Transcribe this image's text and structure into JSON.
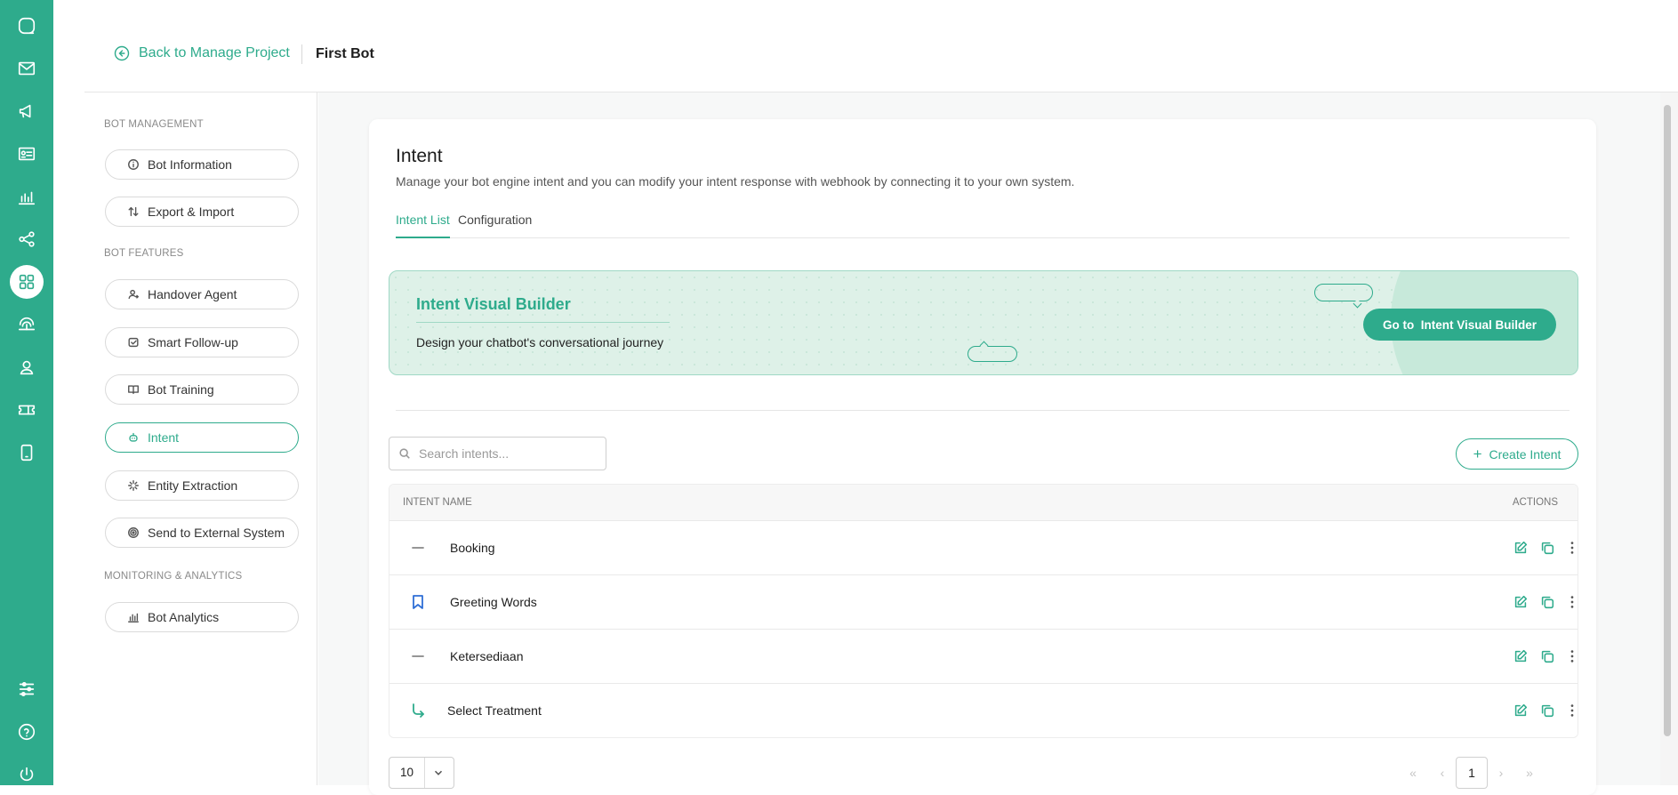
{
  "header": {
    "back_label": "Back to Manage Project",
    "bot_name": "First Bot"
  },
  "sidebar": {
    "sections": [
      {
        "title": "BOT MANAGEMENT"
      },
      {
        "title": "BOT FEATURES"
      },
      {
        "title": "MONITORING & ANALYTICS"
      }
    ],
    "items": [
      {
        "label": "Bot Information",
        "icon": "info-icon"
      },
      {
        "label": "Export & Import",
        "icon": "swap-icon"
      },
      {
        "label": "Handover Agent",
        "icon": "user-icon"
      },
      {
        "label": "Smart Follow-up",
        "icon": "followup-icon"
      },
      {
        "label": "Bot Training",
        "icon": "book-icon"
      },
      {
        "label": "Intent",
        "icon": "bot-icon",
        "active": true
      },
      {
        "label": "Entity Extraction",
        "icon": "sparkle-icon"
      },
      {
        "label": "Send to External System",
        "icon": "target-icon"
      },
      {
        "label": "Bot Analytics",
        "icon": "analytics-icon"
      }
    ]
  },
  "main": {
    "title": "Intent",
    "description": "Manage your bot engine intent and you can modify your intent response with webhook by connecting it to your own system.",
    "tabs": [
      {
        "label": "Intent List",
        "active": true
      },
      {
        "label": "Configuration"
      }
    ],
    "banner": {
      "title": "Intent Visual Builder",
      "subtitle": "Design your chatbot's conversational journey",
      "button_label": "Go to  Intent Visual Builder"
    },
    "search": {
      "placeholder": "Search intents..."
    },
    "create_label": "Create Intent",
    "table": {
      "headers": {
        "name": "INTENT NAME",
        "actions": "ACTIONS"
      },
      "rows": [
        {
          "name": "Booking",
          "icon": "dash-icon"
        },
        {
          "name": "Greeting Words",
          "icon": "bookmark-icon"
        },
        {
          "name": "Ketersediaan",
          "icon": "dash-icon"
        },
        {
          "name": "Select Treatment",
          "icon": "sub-arrow-icon"
        }
      ]
    },
    "pagination": {
      "page_size": "10",
      "current_page": "1"
    }
  },
  "colors": {
    "accent": "#2eab8c",
    "bookmark": "#2f6fd6"
  }
}
